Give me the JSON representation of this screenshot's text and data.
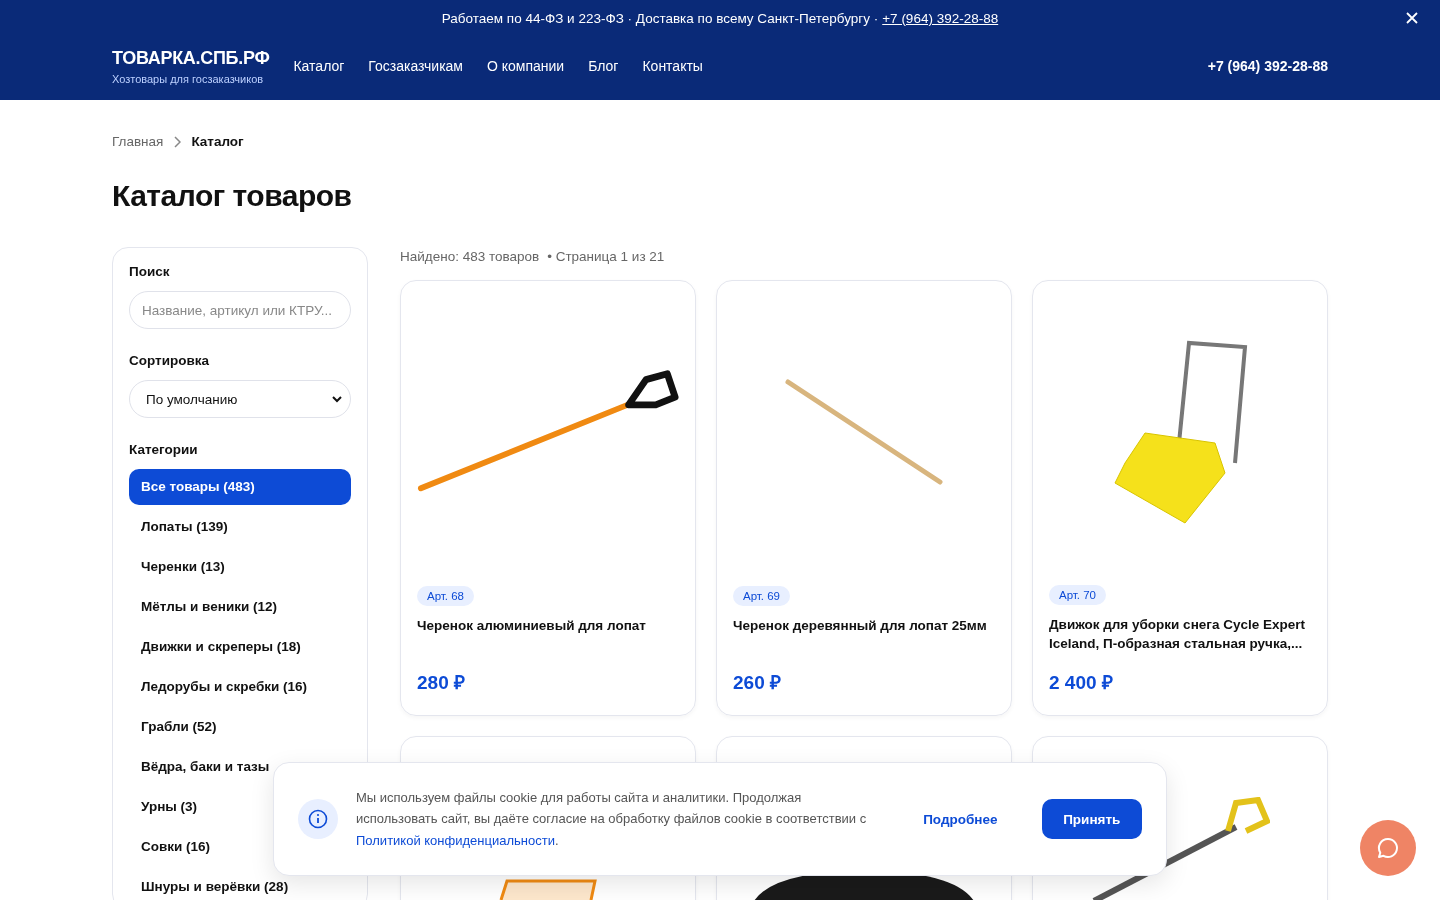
{
  "announcement": {
    "text": "Работаем по 44-ФЗ и 223-ФЗ · Доставка по всему Санкт-Петербургу ·",
    "phone": "+7 (964) 392-28-88"
  },
  "header": {
    "logo": "ТОВАРКА.СПБ.РФ",
    "tagline": "Хозтовары для госзаказчиков",
    "nav": [
      "Каталог",
      "Госзаказчикам",
      "О компании",
      "Блог",
      "Контакты"
    ],
    "phone": "+7 (964) 392-28-88"
  },
  "breadcrumbs": [
    {
      "label": "Главная",
      "current": false
    },
    {
      "label": "Каталог",
      "current": true
    }
  ],
  "title": "Каталог товаров",
  "sidebar": {
    "search": {
      "label": "Поиск",
      "placeholder": "Название, артикул или КТРУ..."
    },
    "sort": {
      "label": "Сортировка",
      "value": "По умолчанию"
    },
    "categories": {
      "label": "Категории",
      "items": [
        {
          "label": "Все товары (483)",
          "selected": true
        },
        {
          "label": "Лопаты (139)",
          "selected": false
        },
        {
          "label": "Черенки (13)",
          "selected": false
        },
        {
          "label": "Мётлы и веники (12)",
          "selected": false
        },
        {
          "label": "Движки и скреперы (18)",
          "selected": false
        },
        {
          "label": "Ледорубы и скребки (16)",
          "selected": false
        },
        {
          "label": "Грабли (52)",
          "selected": false
        },
        {
          "label": "Вёдра, баки и тазы",
          "selected": false
        },
        {
          "label": "Урны (3)",
          "selected": false
        },
        {
          "label": "Совки (16)",
          "selected": false
        },
        {
          "label": "Шнуры и верёвки (28)",
          "selected": false
        }
      ]
    }
  },
  "results": {
    "found": "Найдено: 483 товаров",
    "page": "• Страница 1 из 21"
  },
  "products": [
    {
      "kind": "metal-handle",
      "article": "Арт. 68",
      "name": "Черенок алюминиевый для лопат",
      "price": "280 ₽"
    },
    {
      "kind": "wood-handle",
      "article": "Арт. 69",
      "name": "Черенок деревянный для лопат 25мм",
      "price": "260 ₽"
    },
    {
      "kind": "snow-pusher",
      "article": "Арт. 70",
      "name": "Движок для уборки снега Cycle Expert Iceland, П-образная стальная ручка,...",
      "price": "2 400 ₽"
    },
    {
      "kind": "rake"
    },
    {
      "kind": "black-scoop"
    },
    {
      "kind": "shovel"
    }
  ],
  "cookie": {
    "before": "Мы используем файлы cookie для работы сайта и аналитики. Продолжая использовать сайт, вы даёте согласие на обработку файлов cookie в соответствии с ",
    "link": "Политикой конфиденциальности",
    "after": ".",
    "more": "Подробнее",
    "accept": "Принять"
  }
}
